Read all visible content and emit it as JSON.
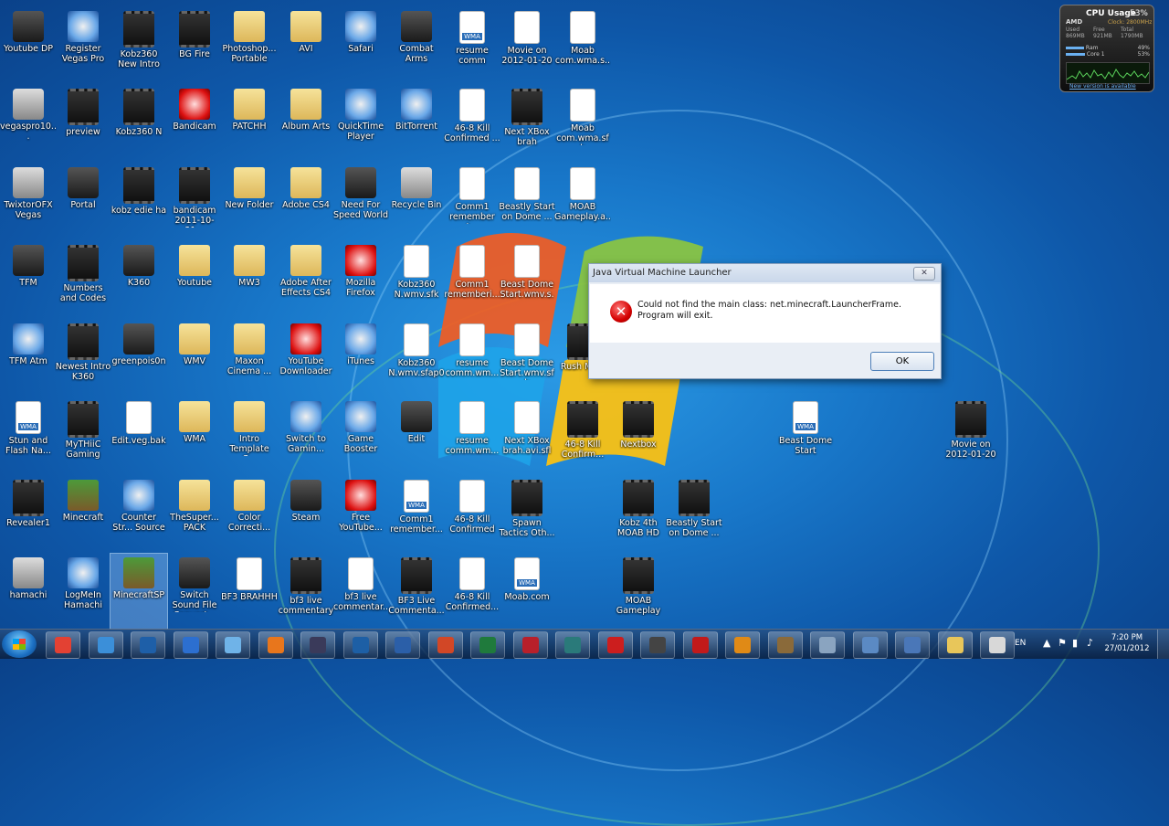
{
  "desktop_icons": [
    {
      "label": "Youtube DP",
      "kind": "app dark",
      "icon": "app-icon",
      "col": 0,
      "row": 0
    },
    {
      "label": "Register Vegas Pro",
      "kind": "app",
      "icon": "chrome-icon",
      "col": 1,
      "row": 0
    },
    {
      "label": "Kobz360 New Intro",
      "kind": "video",
      "icon": "video-icon",
      "col": 2,
      "row": 0
    },
    {
      "label": "BG Fire",
      "kind": "video",
      "icon": "video-icon",
      "col": 3,
      "row": 0
    },
    {
      "label": "Photoshop... Portable",
      "kind": "folder",
      "icon": "folder-icon",
      "col": 4,
      "row": 0
    },
    {
      "label": "AVI",
      "kind": "folder",
      "icon": "folder-icon",
      "col": 5,
      "row": 0
    },
    {
      "label": "Safari",
      "kind": "app",
      "icon": "safari-icon",
      "col": 6,
      "row": 0
    },
    {
      "label": "Combat Arms",
      "kind": "app dark",
      "icon": "combat-arms-icon",
      "col": 7,
      "row": 0
    },
    {
      "label": "resume comm",
      "kind": "wma",
      "icon": "wma-file-icon",
      "col": 8,
      "row": 0
    },
    {
      "label": "Movie on 2012-01-20 ...",
      "kind": "doc",
      "icon": "file-icon",
      "col": 9,
      "row": 0
    },
    {
      "label": "Moab com.wma.s...",
      "kind": "doc",
      "icon": "file-icon",
      "col": 10,
      "row": 0
    },
    {
      "label": "vegaspro10...",
      "kind": "app grey",
      "icon": "installer-icon",
      "col": 0,
      "row": 1
    },
    {
      "label": "preview",
      "kind": "video",
      "icon": "video-icon",
      "col": 1,
      "row": 1
    },
    {
      "label": "Kobz360 N",
      "kind": "video",
      "icon": "video-icon",
      "col": 2,
      "row": 1
    },
    {
      "label": "Bandicam",
      "kind": "app red",
      "icon": "bandicam-icon",
      "col": 3,
      "row": 1
    },
    {
      "label": "PATCHH",
      "kind": "folder",
      "icon": "folder-icon",
      "col": 4,
      "row": 1
    },
    {
      "label": "Album Arts",
      "kind": "folder",
      "icon": "folder-icon",
      "col": 5,
      "row": 1
    },
    {
      "label": "QuickTime Player",
      "kind": "app",
      "icon": "quicktime-icon",
      "col": 6,
      "row": 1
    },
    {
      "label": "BitTorrent",
      "kind": "app",
      "icon": "bittorrent-icon",
      "col": 7,
      "row": 1
    },
    {
      "label": "46-8 Kill Confirmed ...",
      "kind": "doc",
      "icon": "file-icon",
      "col": 8,
      "row": 1
    },
    {
      "label": "Next XBox brah",
      "kind": "video",
      "icon": "video-icon",
      "col": 9,
      "row": 1
    },
    {
      "label": "Moab com.wma.sfk",
      "kind": "doc",
      "icon": "file-icon",
      "col": 10,
      "row": 1
    },
    {
      "label": "TwixtorOFX Vegas",
      "kind": "app grey",
      "icon": "winrar-icon",
      "col": 0,
      "row": 2
    },
    {
      "label": "Portal",
      "kind": "app dark",
      "icon": "portal-icon",
      "col": 1,
      "row": 2
    },
    {
      "label": "kobz edie ha",
      "kind": "video",
      "icon": "video-icon",
      "col": 2,
      "row": 2
    },
    {
      "label": "bandicam 2011-10-31...",
      "kind": "video",
      "icon": "video-icon",
      "col": 3,
      "row": 2
    },
    {
      "label": "New Folder",
      "kind": "folder",
      "icon": "folder-icon",
      "col": 4,
      "row": 2
    },
    {
      "label": "Adobe CS4",
      "kind": "folder",
      "icon": "folder-icon",
      "col": 5,
      "row": 2
    },
    {
      "label": "Need For Speed World",
      "kind": "app dark",
      "icon": "nfs-icon",
      "col": 6,
      "row": 2
    },
    {
      "label": "Recycle Bin",
      "kind": "app grey",
      "icon": "recycle-bin-icon",
      "col": 7,
      "row": 2
    },
    {
      "label": "Comm1 remember t...",
      "kind": "doc",
      "icon": "file-icon",
      "col": 8,
      "row": 2
    },
    {
      "label": "Beastly Start on Dome ...",
      "kind": "doc",
      "icon": "file-icon",
      "col": 9,
      "row": 2
    },
    {
      "label": "MOAB Gameplay.a...",
      "kind": "doc",
      "icon": "file-icon",
      "col": 10,
      "row": 2
    },
    {
      "label": "TFM",
      "kind": "app dark",
      "icon": "tfm-icon",
      "col": 0,
      "row": 3
    },
    {
      "label": "Numbers and Codes",
      "kind": "video",
      "icon": "video-icon",
      "col": 1,
      "row": 3
    },
    {
      "label": "K360",
      "kind": "app dark",
      "icon": "k360-icon",
      "col": 2,
      "row": 3
    },
    {
      "label": "Youtube",
      "kind": "folder",
      "icon": "folder-icon",
      "col": 3,
      "row": 3
    },
    {
      "label": "MW3",
      "kind": "folder",
      "icon": "folder-icon",
      "col": 4,
      "row": 3
    },
    {
      "label": "Adobe After Effects CS4",
      "kind": "folder",
      "icon": "folder-icon",
      "col": 5,
      "row": 3
    },
    {
      "label": "Mozilla Firefox",
      "kind": "app red",
      "icon": "firefox-icon",
      "col": 6,
      "row": 3
    },
    {
      "label": "Kobz360 N.wmv.sfk",
      "kind": "doc",
      "icon": "file-icon",
      "col": 7,
      "row": 3
    },
    {
      "label": "Comm1 rememberi...",
      "kind": "doc",
      "icon": "file-icon",
      "col": 8,
      "row": 3
    },
    {
      "label": "Beast Dome Start.wmv.s...",
      "kind": "doc",
      "icon": "file-icon",
      "col": 9,
      "row": 3
    },
    {
      "label": "TFM Atm",
      "kind": "app",
      "icon": "app-icon",
      "col": 0,
      "row": 4
    },
    {
      "label": "Newest Intro K360",
      "kind": "video",
      "icon": "video-icon",
      "col": 1,
      "row": 4
    },
    {
      "label": "greenpois0n",
      "kind": "app dark",
      "icon": "greenpois0n-icon",
      "col": 2,
      "row": 4
    },
    {
      "label": "WMV",
      "kind": "folder",
      "icon": "folder-icon",
      "col": 3,
      "row": 4
    },
    {
      "label": "Maxon Cinema ...",
      "kind": "folder",
      "icon": "folder-icon",
      "col": 4,
      "row": 4
    },
    {
      "label": "YouTube Downloader",
      "kind": "app red",
      "icon": "youtube-downloader-icon",
      "col": 5,
      "row": 4
    },
    {
      "label": "iTunes",
      "kind": "app",
      "icon": "itunes-icon",
      "col": 6,
      "row": 4
    },
    {
      "label": "Kobz360 N.wmv.sfap0",
      "kind": "doc",
      "icon": "file-icon",
      "col": 7,
      "row": 4
    },
    {
      "label": "resume comm.wm...",
      "kind": "doc",
      "icon": "file-icon",
      "col": 8,
      "row": 4
    },
    {
      "label": "Beast Dome Start.wmv.sfk",
      "kind": "doc",
      "icon": "file-icon",
      "col": 9,
      "row": 4
    },
    {
      "label": "Rush MOA",
      "kind": "video",
      "icon": "video-icon",
      "col": 10,
      "row": 4
    },
    {
      "label": "Stun and Flash Na...",
      "kind": "wma",
      "icon": "mp3-file-icon",
      "col": 0,
      "row": 5
    },
    {
      "label": "MyTHiiC Gaming",
      "kind": "video",
      "icon": "video-icon",
      "col": 1,
      "row": 5
    },
    {
      "label": "Edit.veg.bak",
      "kind": "doc",
      "icon": "file-icon",
      "col": 2,
      "row": 5
    },
    {
      "label": "WMA",
      "kind": "folder",
      "icon": "folder-icon",
      "col": 3,
      "row": 5
    },
    {
      "label": "Intro Template C...",
      "kind": "folder",
      "icon": "folder-icon",
      "col": 4,
      "row": 5
    },
    {
      "label": "Switch to Gamin...",
      "kind": "app",
      "icon": "switch-gaming-icon",
      "col": 5,
      "row": 5
    },
    {
      "label": "Game Booster",
      "kind": "app",
      "icon": "game-booster-icon",
      "col": 6,
      "row": 5
    },
    {
      "label": "Edit",
      "kind": "app dark",
      "icon": "vegas-project-icon",
      "col": 7,
      "row": 5
    },
    {
      "label": "resume comm.wm...",
      "kind": "doc",
      "icon": "file-icon",
      "col": 8,
      "row": 5
    },
    {
      "label": "Next XBox brah.avi.sfl",
      "kind": "doc",
      "icon": "file-icon",
      "col": 9,
      "row": 5
    },
    {
      "label": "46-8 Kill Confirm...",
      "kind": "video",
      "icon": "video-icon",
      "col": 10,
      "row": 5
    },
    {
      "label": "Nextbox",
      "kind": "video",
      "icon": "video-icon",
      "col": 11,
      "row": 5
    },
    {
      "label": "Revealer1",
      "kind": "video",
      "icon": "video-icon",
      "col": 0,
      "row": 6
    },
    {
      "label": "Minecraft",
      "kind": "app green",
      "icon": "minecraft-icon",
      "col": 1,
      "row": 6
    },
    {
      "label": "Counter Str... Source",
      "kind": "app",
      "icon": "counter-strike-icon",
      "col": 2,
      "row": 6
    },
    {
      "label": "TheSuper... PACK",
      "kind": "folder",
      "icon": "folder-icon",
      "col": 3,
      "row": 6
    },
    {
      "label": "Color Correcti...",
      "kind": "folder",
      "icon": "folder-icon",
      "col": 4,
      "row": 6
    },
    {
      "label": "Steam",
      "kind": "app dark",
      "icon": "steam-icon",
      "col": 5,
      "row": 6
    },
    {
      "label": "Free YouTube...",
      "kind": "app red",
      "icon": "free-youtube-icon",
      "col": 6,
      "row": 6
    },
    {
      "label": "Comm1 remember...",
      "kind": "wma",
      "icon": "wma-file-icon",
      "col": 7,
      "row": 6
    },
    {
      "label": "46-8 Kill Confirmed",
      "kind": "doc",
      "icon": "avi-file-icon",
      "col": 8,
      "row": 6
    },
    {
      "label": "Spawn Tactics Oth...",
      "kind": "video",
      "icon": "video-icon",
      "col": 9,
      "row": 6
    },
    {
      "label": "Kobz 4th MOAB HD",
      "kind": "video",
      "icon": "video-icon",
      "col": 11,
      "row": 6
    },
    {
      "label": "Beastly Start on Dome ...",
      "kind": "video",
      "icon": "video-icon",
      "col": 12,
      "row": 6
    },
    {
      "label": "hamachi",
      "kind": "app grey",
      "icon": "installer-icon",
      "col": 0,
      "row": 7
    },
    {
      "label": "LogMeIn Hamachi",
      "kind": "app",
      "icon": "hamachi-icon",
      "col": 1,
      "row": 7
    },
    {
      "label": "MinecraftSP",
      "kind": "app green sel",
      "icon": "minecraft-icon",
      "col": 2,
      "row": 7
    },
    {
      "label": "Switch Sound File Convert...",
      "kind": "app dark",
      "icon": "switch-sound-icon",
      "col": 3,
      "row": 7
    },
    {
      "label": "BF3 BRAHHH",
      "kind": "doc",
      "icon": "audio-file-icon",
      "col": 4,
      "row": 7
    },
    {
      "label": "bf3 live commentary",
      "kind": "video",
      "icon": "video-icon",
      "col": 5,
      "row": 7
    },
    {
      "label": "bf3 live commentar...",
      "kind": "doc",
      "icon": "file-icon",
      "col": 6,
      "row": 7
    },
    {
      "label": "BF3 Live Commenta...",
      "kind": "video",
      "icon": "video-icon",
      "col": 7,
      "row": 7
    },
    {
      "label": "46-8 Kill Confirmed...",
      "kind": "doc",
      "icon": "file-icon",
      "col": 8,
      "row": 7
    },
    {
      "label": "Moab.com",
      "kind": "wma",
      "icon": "wma-file-icon",
      "col": 9,
      "row": 7
    },
    {
      "label": "MOAB Gameplay",
      "kind": "video",
      "icon": "video-icon",
      "col": 11,
      "row": 7
    }
  ],
  "extra_icons": [
    {
      "label": "Beast Dome Start",
      "kind": "wma",
      "icon": "wma-file-icon",
      "slot": "a"
    },
    {
      "label": "Movie on 2012-01-20 ...",
      "kind": "video",
      "icon": "video-icon",
      "slot": "b"
    }
  ],
  "gadget": {
    "title": "CPU Usage",
    "percent": "53%",
    "brand": "AMD",
    "clock": "Clock: 2800MHz",
    "mem_headers": [
      "Used",
      "Free",
      "Total"
    ],
    "mem_values": [
      "869MB",
      "921MB",
      "1790MB"
    ],
    "ram_label": "Ram",
    "ram_pct": "49%",
    "ram_fraction": 0.49,
    "core_label": "Core 1",
    "core_pct": "53%",
    "core_fraction": 0.53,
    "link": "New version is available"
  },
  "dialog": {
    "title": "Java Virtual Machine Launcher",
    "close_label": "✕",
    "message": "Could not find the main class: net.minecraft.LauncherFrame.  Program will exit.",
    "ok_label": "OK"
  },
  "taskbar": {
    "pinned": [
      {
        "name": "chrome",
        "color": "#e34133"
      },
      {
        "name": "itunes",
        "color": "#3b8fd9"
      },
      {
        "name": "media-center",
        "color": "#1e5fa8"
      },
      {
        "name": "globe",
        "color": "#2c6fd0"
      },
      {
        "name": "safari",
        "color": "#6fb3e8"
      },
      {
        "name": "firefox",
        "color": "#e8761c"
      },
      {
        "name": "after-effects",
        "color": "#3a3a5a"
      },
      {
        "name": "photoshop",
        "color": "#1d5fa5"
      },
      {
        "name": "word",
        "color": "#2b5fa8"
      },
      {
        "name": "powerpoint",
        "color": "#d24726"
      },
      {
        "name": "excel",
        "color": "#1f7a3c"
      },
      {
        "name": "acrobat-pro",
        "color": "#b8202a"
      },
      {
        "name": "publisher",
        "color": "#2a7a7a"
      },
      {
        "name": "acrobat",
        "color": "#cc1e1e"
      },
      {
        "name": "capture-card",
        "color": "#444444"
      },
      {
        "name": "free-youtube",
        "color": "#c21a1a"
      },
      {
        "name": "media-player",
        "color": "#e08a16"
      },
      {
        "name": "tool",
        "color": "#8a6a3a"
      },
      {
        "name": "scissors",
        "color": "#8aa4c0"
      },
      {
        "name": "paint",
        "color": "#5b8ac4"
      },
      {
        "name": "network",
        "color": "#4a77b8"
      },
      {
        "name": "explorer",
        "color": "#e8c65a"
      },
      {
        "name": "java",
        "color": "#d8d8d8"
      }
    ],
    "language": "EN",
    "time": "7:20 PM",
    "date": "27/01/2012"
  }
}
